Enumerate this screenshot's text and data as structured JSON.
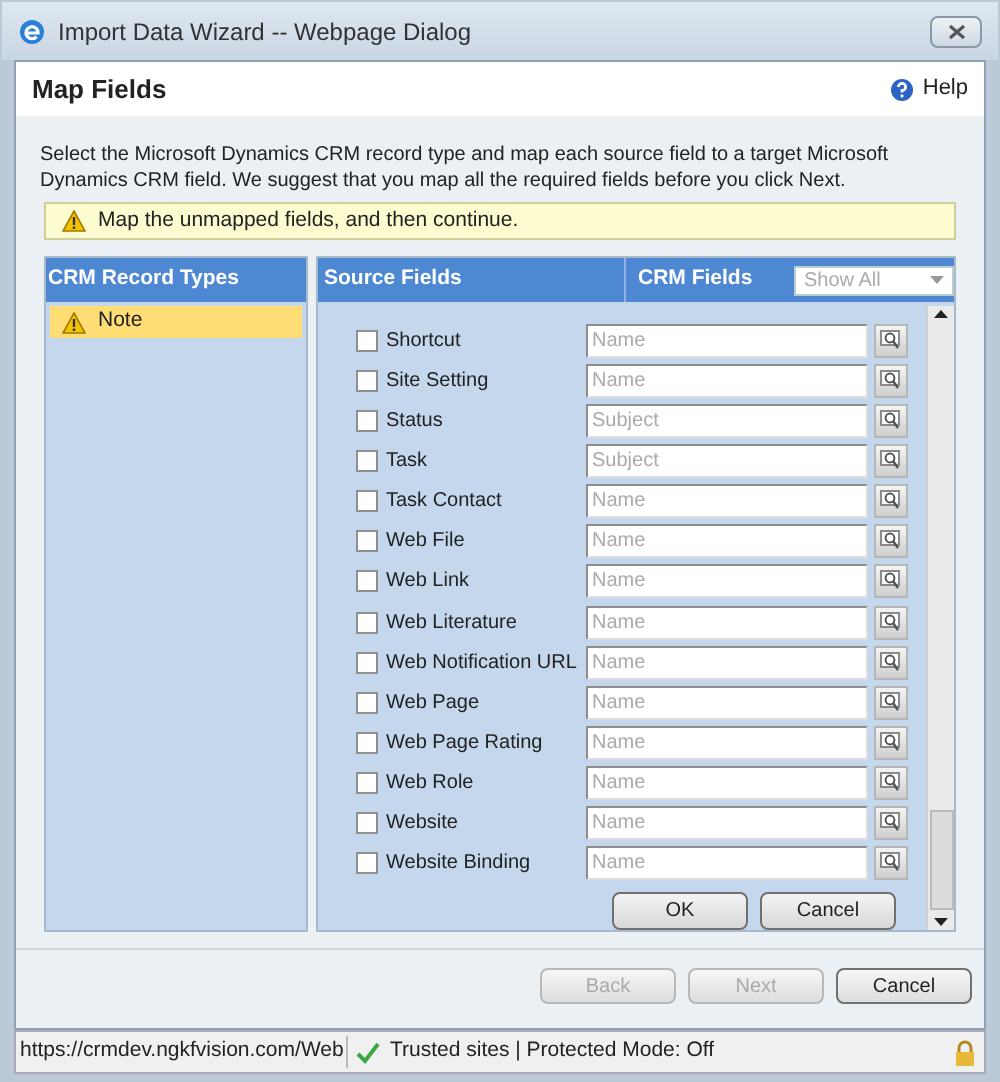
{
  "window": {
    "title": "Import Data Wizard -- Webpage Dialog"
  },
  "header": {
    "title": "Map Fields",
    "help": "Help"
  },
  "description": "Select the Microsoft Dynamics CRM record type and map each source field to a target Microsoft Dynamics CRM field. We suggest that you map all the required fields before you click Next.",
  "warning": "Map the unmapped fields, and then continue.",
  "record_types": {
    "title": "CRM Record Types",
    "items": [
      {
        "label": "Note",
        "selected": true,
        "warning": true
      }
    ]
  },
  "mapping": {
    "source_heading": "Source Fields",
    "crm_heading": "CRM Fields",
    "filter": "Show All",
    "rows": [
      {
        "label": "Shortcut",
        "checked": false,
        "placeholder": "Name"
      },
      {
        "label": "Site Setting",
        "checked": false,
        "placeholder": "Name"
      },
      {
        "label": "Status",
        "checked": false,
        "placeholder": "Subject"
      },
      {
        "label": "Task",
        "checked": false,
        "placeholder": "Subject"
      },
      {
        "label": "Task Contact",
        "checked": false,
        "placeholder": "Name"
      },
      {
        "label": "Web File",
        "checked": false,
        "placeholder": "Name"
      },
      {
        "label": "Web Link",
        "checked": false,
        "placeholder": "Name"
      },
      {
        "label": "Web Literature",
        "checked": false,
        "placeholder": "Name"
      },
      {
        "label": "Web Notification URL",
        "checked": false,
        "placeholder": "Name"
      },
      {
        "label": "Web Page",
        "checked": false,
        "placeholder": "Name"
      },
      {
        "label": "Web Page Rating",
        "checked": false,
        "placeholder": "Name"
      },
      {
        "label": "Web Role",
        "checked": false,
        "placeholder": "Name"
      },
      {
        "label": "Website",
        "checked": false,
        "placeholder": "Name"
      },
      {
        "label": "Website Binding",
        "checked": false,
        "placeholder": "Name"
      }
    ],
    "buttons": [
      "OK",
      "Cancel"
    ]
  },
  "footer_buttons": [
    {
      "label": "Back",
      "disabled": true
    },
    {
      "label": "Next",
      "disabled": true
    },
    {
      "label": "Cancel",
      "disabled": false
    }
  ],
  "status_bar": {
    "url": "https://crmdev.ngkfvision.com/Web",
    "zone": "Trusted sites | Protected Mode: Off"
  }
}
